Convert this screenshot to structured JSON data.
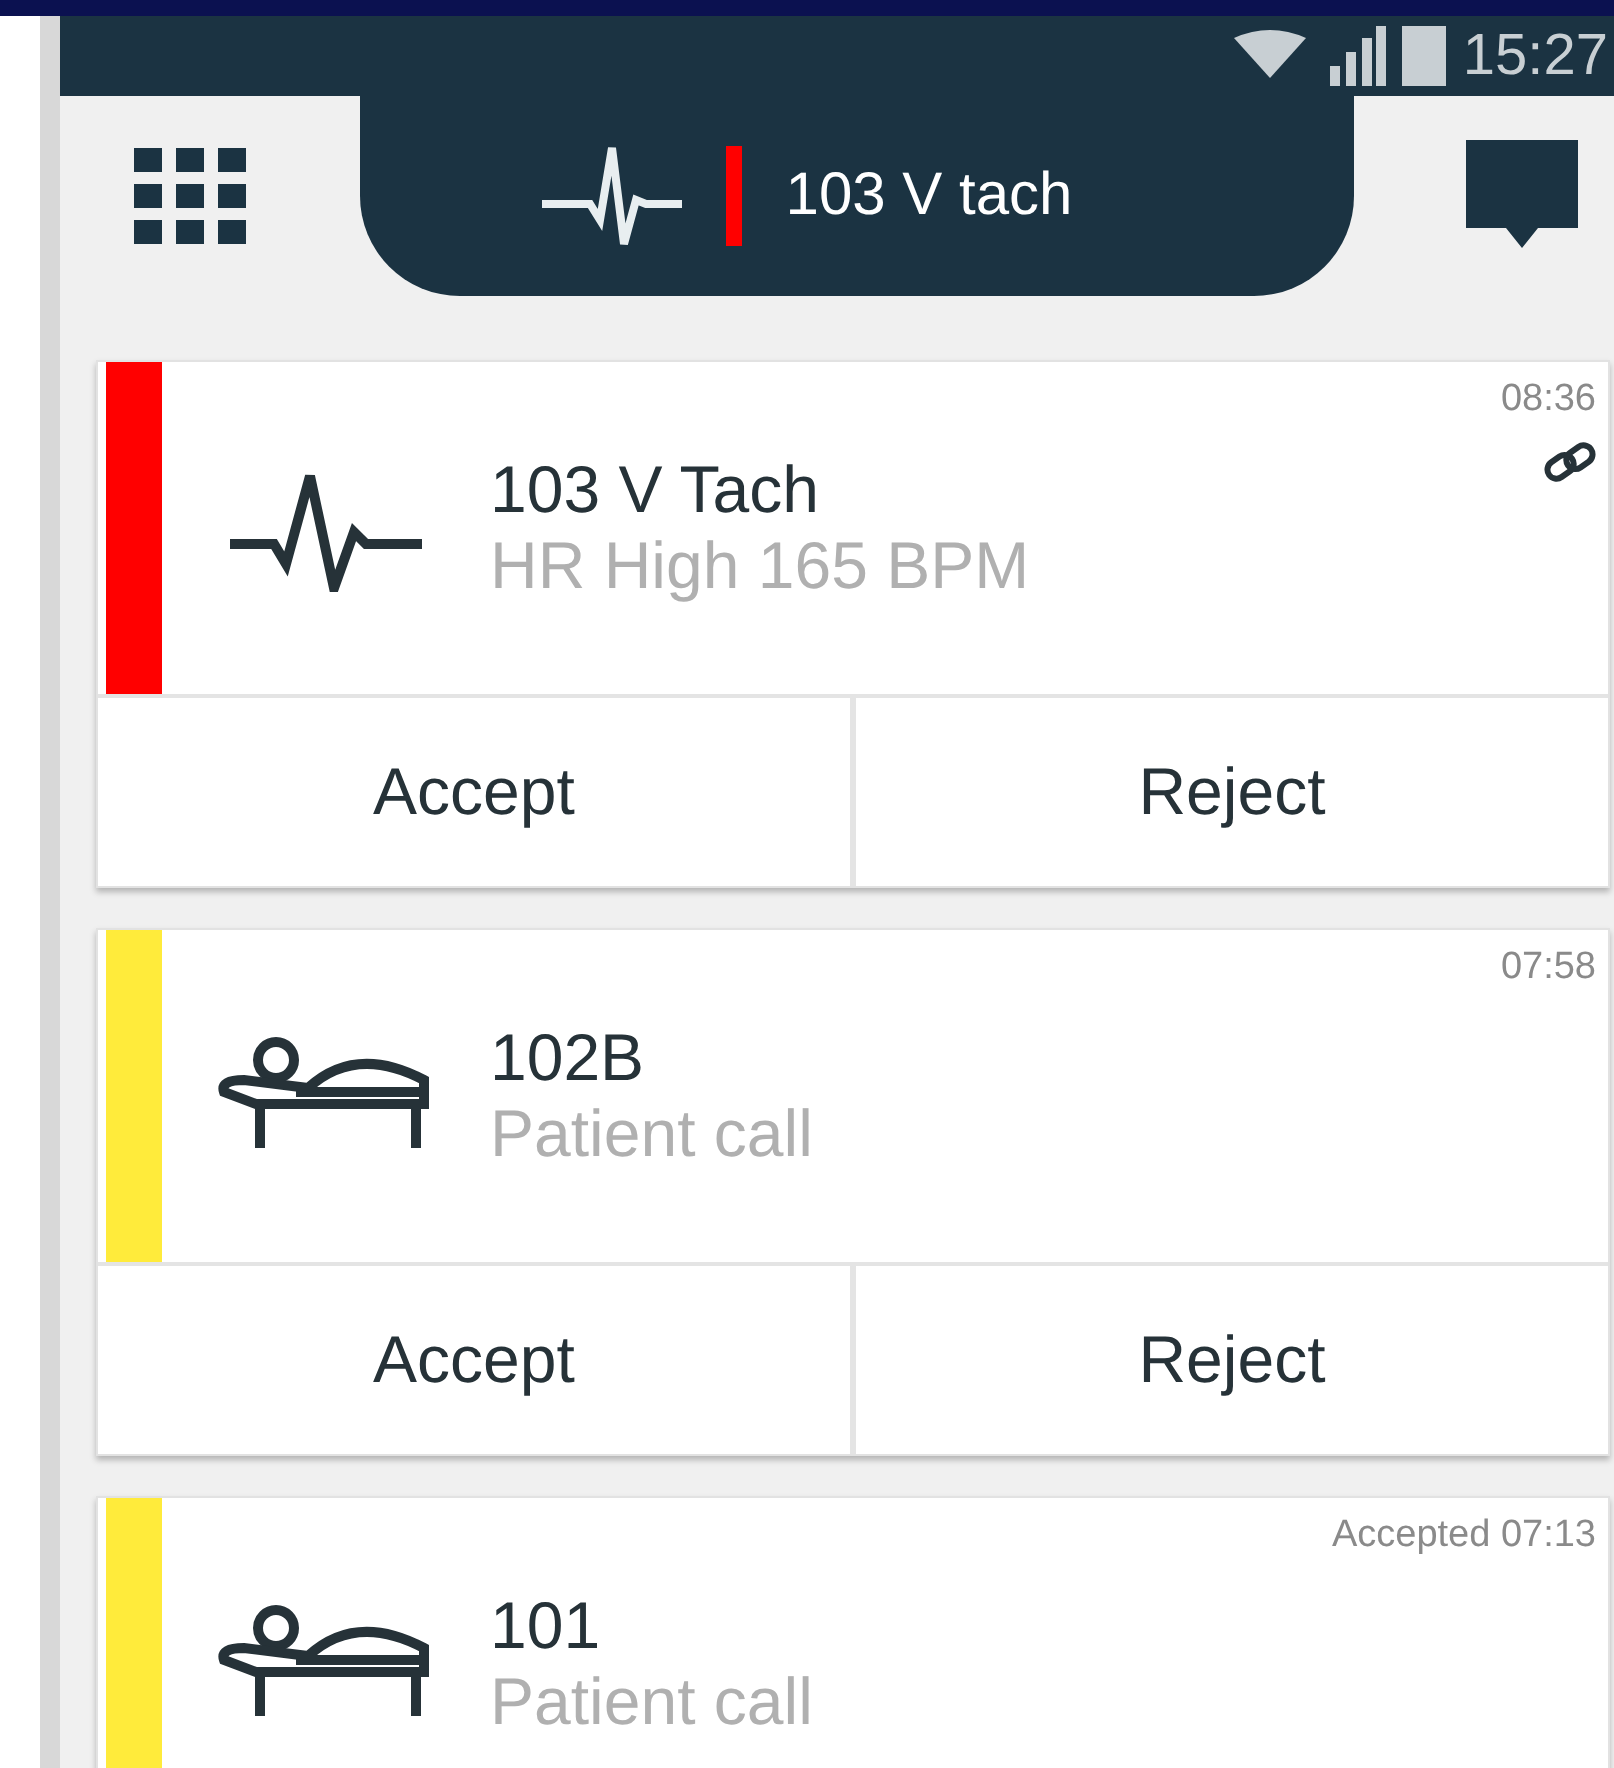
{
  "status_bar": {
    "time": "15:27"
  },
  "header": {
    "title": "103 V tach"
  },
  "alarms": [
    {
      "kind": "heart",
      "color": "#ff0000",
      "title": "103 V Tach",
      "subtitle": "HR High 165 BPM",
      "time": "08:36",
      "linked": true,
      "actions": [
        "Accept",
        "Reject"
      ]
    },
    {
      "kind": "bed",
      "color": "#ffeb3b",
      "title": "102B",
      "subtitle": "Patient call",
      "time": "07:58",
      "linked": false,
      "actions": [
        "Accept",
        "Reject"
      ]
    },
    {
      "kind": "bed",
      "color": "#ffeb3b",
      "title": "101",
      "subtitle": "Patient call",
      "time": "Accepted 07:13",
      "linked": false
    }
  ]
}
